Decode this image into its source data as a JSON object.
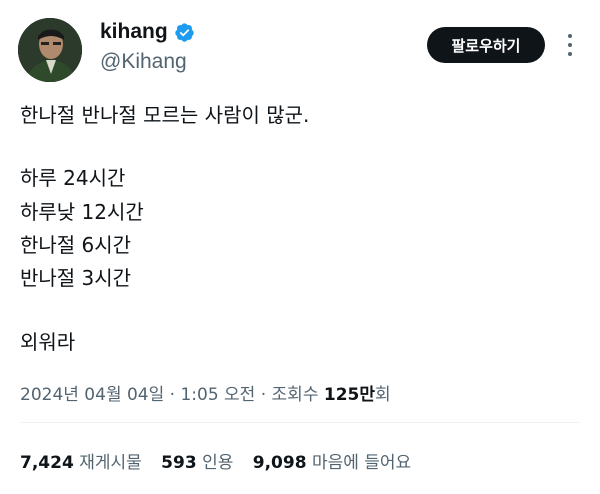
{
  "author": {
    "display_name": "kihang",
    "handle": "@Kihang",
    "verified_color": "#1d9bf0"
  },
  "follow_button": {
    "label": "팔로우하기"
  },
  "more_icon": "more-vertical-icon",
  "tweet": {
    "lines": [
      "한나절 반나절 모르는 사람이 많군.",
      "하루 24시간",
      "하루낮 12시간",
      "한나절 6시간",
      "반나절 3시간",
      "외워라"
    ]
  },
  "meta": {
    "datetime": "2024년 04월 04일 · 1:05 오전 · 조회수 ",
    "views": "125만",
    "views_suffix": "회"
  },
  "stats": {
    "retweets": {
      "count": "7,424",
      "label": "재게시물"
    },
    "quotes": {
      "count": "593",
      "label": "인용"
    },
    "likes": {
      "count": "9,098",
      "label": "마음에 들어요"
    }
  }
}
